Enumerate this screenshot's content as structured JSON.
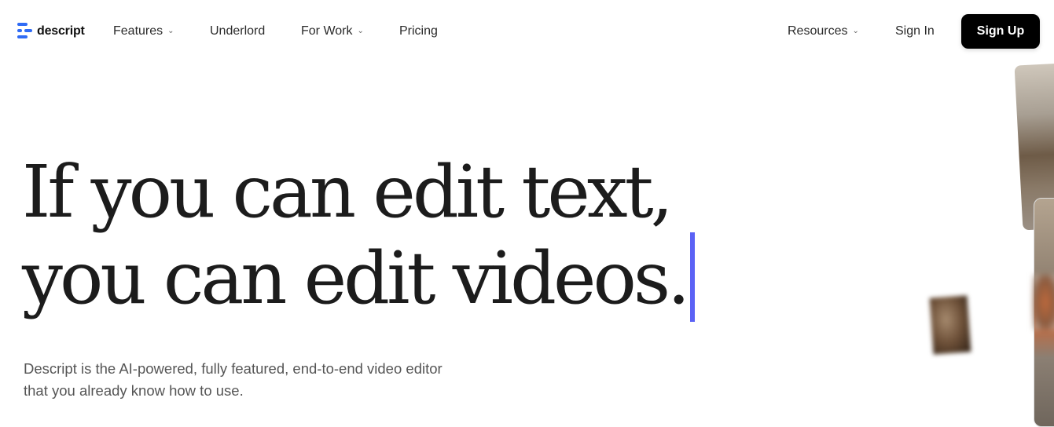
{
  "nav": {
    "logo": {
      "icon": "descript-logo-icon",
      "text": "descript",
      "color": "#2f6bf5"
    },
    "items": [
      {
        "label": "Features",
        "has_dropdown": true
      },
      {
        "label": "Underlord",
        "has_dropdown": false
      },
      {
        "label": "For Work",
        "has_dropdown": true
      },
      {
        "label": "Pricing",
        "has_dropdown": false
      }
    ],
    "right_items": [
      {
        "label": "Resources",
        "has_dropdown": true
      },
      {
        "label": "Sign In",
        "has_dropdown": false
      }
    ],
    "chevron_glyph": "⌄",
    "cta": {
      "label": "Sign Up",
      "background": "#000000"
    }
  },
  "hero": {
    "headline_line1": "If you can edit text,",
    "headline_line2": "you can edit videos.",
    "cursor_color": "#5b62f5",
    "subheadline_line1": "Descript is the AI-powered, fully featured, end-to-end video editor",
    "subheadline_line2": "that you already know how to use."
  },
  "media": {
    "items": [
      {
        "description": "Video clip of a person in a workshop studio"
      },
      {
        "description": "Tall vertical video clip"
      },
      {
        "description": "Blurred video thumbnail"
      },
      {
        "description": "Blurred video thumbnail"
      }
    ]
  }
}
